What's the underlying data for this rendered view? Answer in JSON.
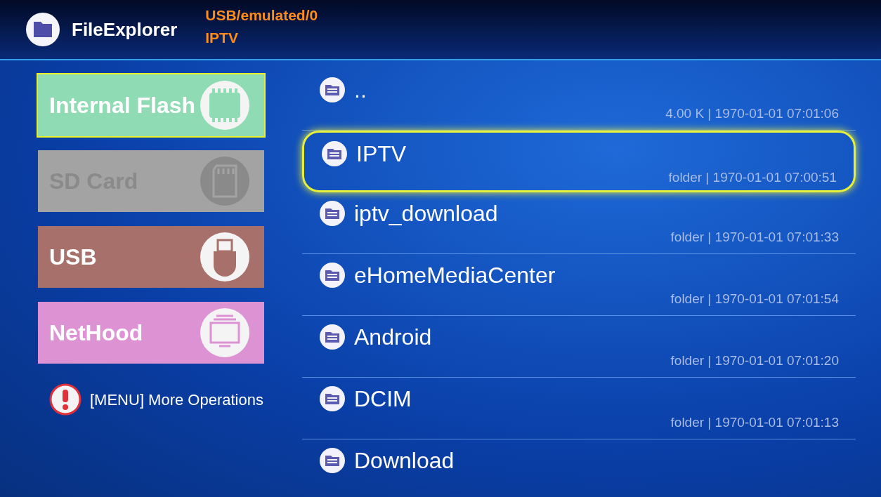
{
  "app": {
    "title": "FileExplorer"
  },
  "path": [
    "USB/emulated/0",
    "IPTV"
  ],
  "storages": [
    {
      "label": "Internal Flash",
      "kind": "chip",
      "color": "#8fdcb4",
      "selected": true,
      "disabled": false
    },
    {
      "label": "SD Card",
      "kind": "sdcard",
      "color": "#a3a3a3",
      "selected": false,
      "disabled": true
    },
    {
      "label": "USB",
      "kind": "usb",
      "color": "#a8706a",
      "selected": false,
      "disabled": false
    },
    {
      "label": "NetHood",
      "kind": "monitor",
      "color": "#dd92d3",
      "selected": false,
      "disabled": false
    }
  ],
  "hint": "[MENU] More Operations",
  "files": [
    {
      "name": "..",
      "meta": "4.00 K | 1970-01-01 07:01:06",
      "selected": false
    },
    {
      "name": "IPTV",
      "meta": "folder | 1970-01-01 07:00:51",
      "selected": true
    },
    {
      "name": "iptv_download",
      "meta": "folder | 1970-01-01 07:01:33",
      "selected": false
    },
    {
      "name": "eHomeMediaCenter",
      "meta": "folder | 1970-01-01 07:01:54",
      "selected": false
    },
    {
      "name": "Android",
      "meta": "folder | 1970-01-01 07:01:20",
      "selected": false
    },
    {
      "name": "DCIM",
      "meta": "folder | 1970-01-01 07:01:13",
      "selected": false
    },
    {
      "name": "Download",
      "selected": false
    }
  ]
}
